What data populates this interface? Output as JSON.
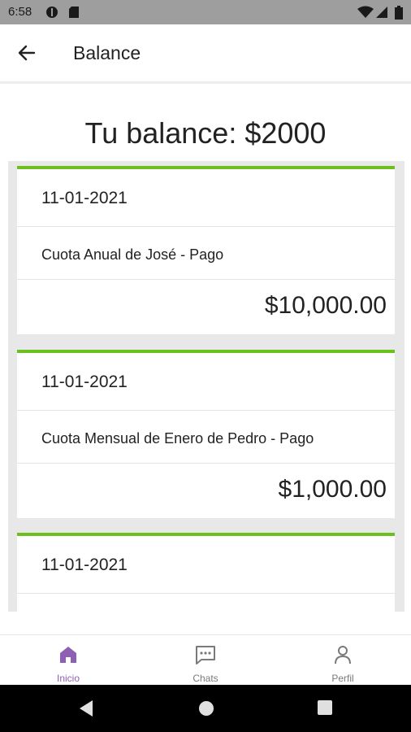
{
  "status_bar": {
    "time": "6:58",
    "icons": [
      "data-saver-icon",
      "sd-card-icon",
      "wifi-icon",
      "signal-icon",
      "battery-icon"
    ]
  },
  "app_bar": {
    "back_icon": "arrow-left-icon",
    "title": "Balance"
  },
  "balance_text": "Tu balance: $2000",
  "transactions": [
    {
      "date": "11-01-2021",
      "description": "Cuota Anual de José - Pago",
      "amount": "$10,000.00"
    },
    {
      "date": "11-01-2021",
      "description": "Cuota Mensual de Enero de Pedro - Pago",
      "amount": "$1,000.00"
    },
    {
      "date": "11-01-2021",
      "description": "",
      "amount": ""
    }
  ],
  "bottom_nav": {
    "items": [
      {
        "label": "Inicio",
        "icon": "home-icon",
        "active": true
      },
      {
        "label": "Chats",
        "icon": "chat-icon",
        "active": false
      },
      {
        "label": "Perfil",
        "icon": "person-icon",
        "active": false
      }
    ]
  },
  "colors": {
    "accent_green": "#6cbf1f",
    "active_nav": "#8e5fb3",
    "status_bar": "#9e9e9e"
  }
}
